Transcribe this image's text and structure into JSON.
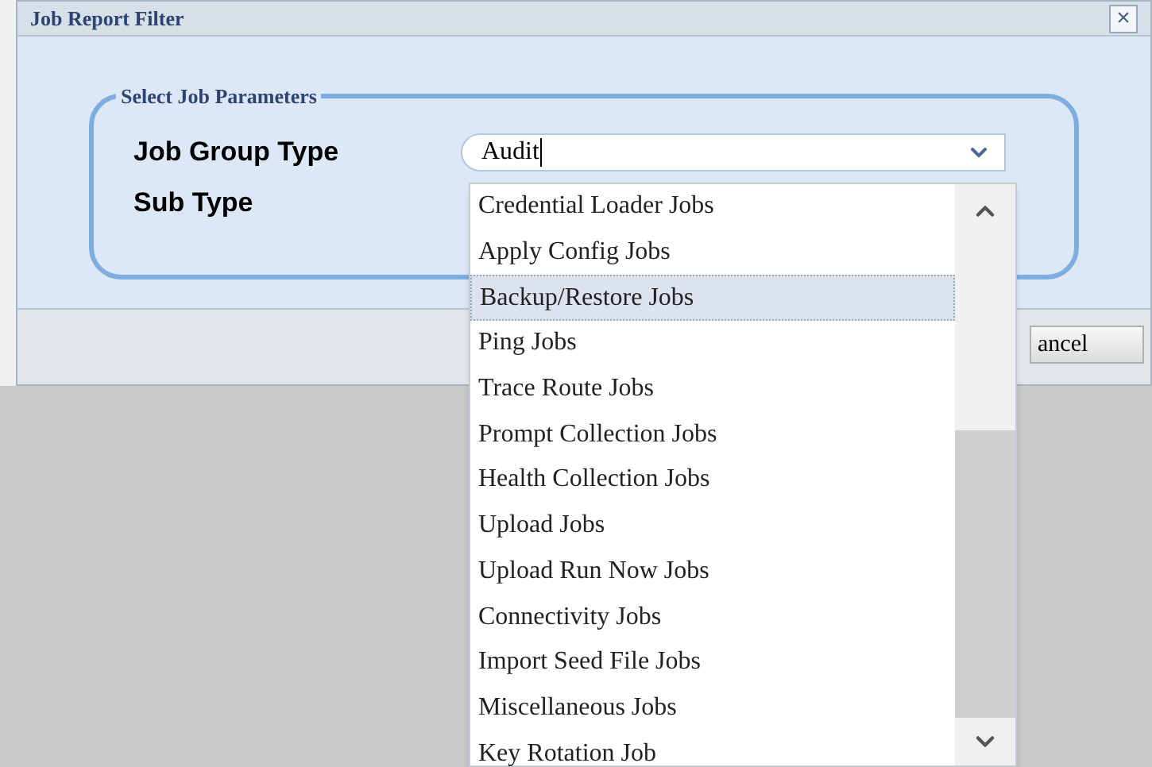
{
  "dialog": {
    "title": "Job Report Filter",
    "close": "×"
  },
  "fieldset": {
    "legend": "Select Job Parameters"
  },
  "fields": [
    {
      "label": "Job Group Type",
      "value": "Audit",
      "kind": "combo"
    },
    {
      "label": "Sub Type",
      "kind": "empty"
    }
  ],
  "dropdown": {
    "items": [
      {
        "label": "Credential Loader Jobs",
        "selected": false
      },
      {
        "label": "Apply Config Jobs",
        "selected": false
      },
      {
        "label": "Backup/Restore Jobs",
        "selected": true
      },
      {
        "label": "Ping Jobs",
        "selected": false
      },
      {
        "label": "Trace Route Jobs",
        "selected": false
      },
      {
        "label": "Prompt Collection Jobs",
        "selected": false
      },
      {
        "label": "Health Collection Jobs",
        "selected": false
      },
      {
        "label": "Upload Jobs",
        "selected": false
      },
      {
        "label": "Upload Run Now Jobs",
        "selected": false
      },
      {
        "label": "Connectivity Jobs",
        "selected": false
      },
      {
        "label": "Import Seed File Jobs",
        "selected": false
      },
      {
        "label": "Miscellaneous Jobs",
        "selected": false
      },
      {
        "label": "Key Rotation Job",
        "selected": false
      }
    ]
  },
  "buttons": [
    "ancel"
  ]
}
